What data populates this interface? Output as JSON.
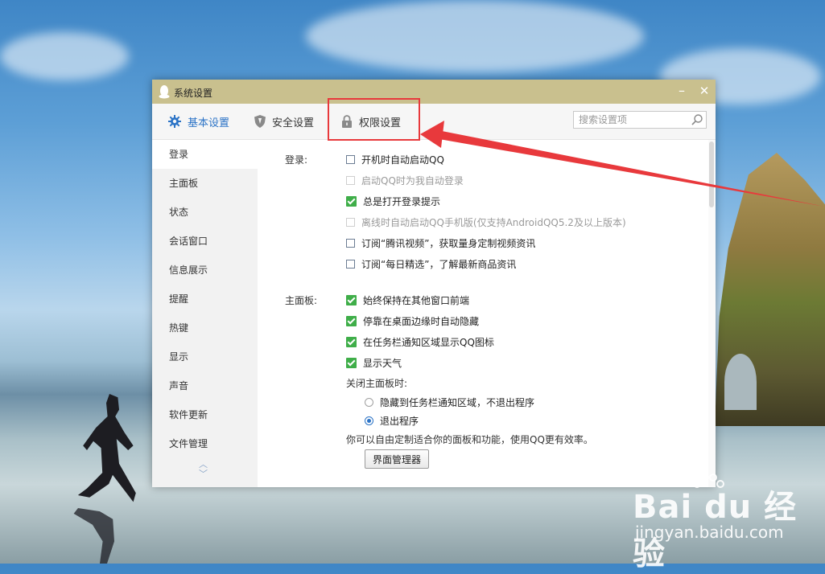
{
  "window": {
    "title": "系统设置",
    "minimize_glyph": "–",
    "close_glyph": "✕"
  },
  "toolbar": {
    "tabs": [
      {
        "label": "基本设置",
        "icon": "gear-icon",
        "color": "#2b73c6"
      },
      {
        "label": "安全设置",
        "icon": "shield-icon"
      },
      {
        "label": "权限设置",
        "icon": "lock-icon"
      }
    ],
    "search_placeholder": "搜索设置项",
    "search_value": ""
  },
  "sidebar": {
    "items": [
      "登录",
      "主面板",
      "状态",
      "会话窗口",
      "信息展示",
      "提醒",
      "热键",
      "显示",
      "声音",
      "软件更新",
      "文件管理"
    ],
    "active_index": 0,
    "arrow_up": "︿",
    "arrow_down": "﹀"
  },
  "login": {
    "label": "登录:",
    "options": [
      {
        "text": "开机时自动启动QQ",
        "checked": false,
        "disabled": false
      },
      {
        "text": "启动QQ时为我自动登录",
        "checked": false,
        "disabled": true
      },
      {
        "text": "总是打开登录提示",
        "checked": true,
        "disabled": false
      },
      {
        "text": "离线时自动启动QQ手机版(仅支持AndroidQQ5.2及以上版本)",
        "checked": false,
        "disabled": true
      },
      {
        "text": "订阅“腾讯视频”，获取量身定制视频资讯",
        "checked": false,
        "disabled": false
      },
      {
        "text": "订阅“每日精选”，了解最新商品资讯",
        "checked": false,
        "disabled": false
      }
    ]
  },
  "main_panel": {
    "label": "主面板:",
    "options": [
      {
        "text": "始终保持在其他窗口前端",
        "checked": true
      },
      {
        "text": "停靠在桌面边缘时自动隐藏",
        "checked": true
      },
      {
        "text": "在任务栏通知区域显示QQ图标",
        "checked": true
      },
      {
        "text": "显示天气",
        "checked": true
      }
    ],
    "close_label": "关闭主面板时:",
    "radios": [
      {
        "text": "隐藏到任务栏通知区域，不退出程序",
        "checked": false
      },
      {
        "text": "退出程序",
        "checked": true
      }
    ],
    "hint": "你可以自由定制适合你的面板和功能，使用QQ更有效率。",
    "manager_button": "界面管理器"
  },
  "watermark": {
    "brand": "Bai du 经验",
    "url": "jingyan.baidu.com"
  },
  "colors": {
    "accent": "#2b73c6",
    "check_green": "#3fae49",
    "annotation_red": "#e8393c",
    "titlebar": "#c9c08e"
  }
}
